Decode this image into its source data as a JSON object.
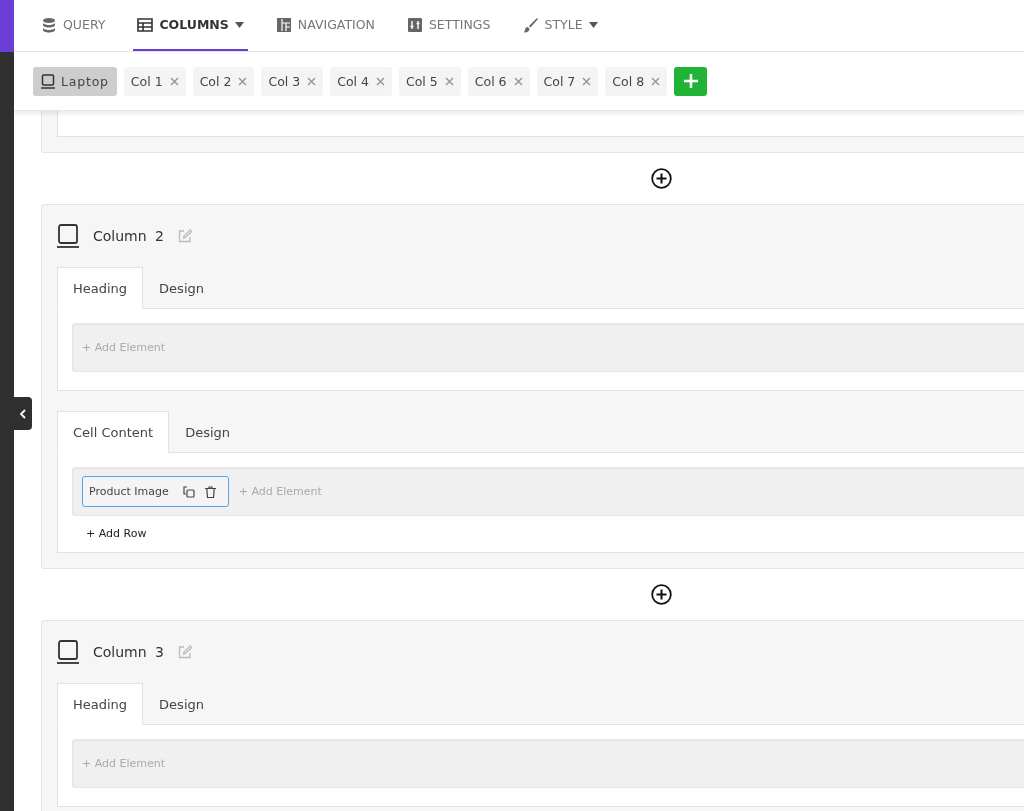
{
  "nav_tabs": [
    {
      "label": "QUERY",
      "selected": false,
      "has_menu": false
    },
    {
      "label": "COLUMNS",
      "selected": true,
      "has_menu": true
    },
    {
      "label": "NAVIGATION",
      "selected": false,
      "has_menu": false
    },
    {
      "label": "SETTINGS",
      "selected": false,
      "has_menu": false
    },
    {
      "label": "STYLE",
      "selected": false,
      "has_menu": true
    }
  ],
  "device": {
    "label": "Laptop",
    "selected": true
  },
  "column_chips": [
    {
      "label": "Col 1"
    },
    {
      "label": "Col 2"
    },
    {
      "label": "Col 3"
    },
    {
      "label": "Col 4"
    },
    {
      "label": "Col 5"
    },
    {
      "label": "Col 6"
    },
    {
      "label": "Col 7"
    },
    {
      "label": "Col 8"
    }
  ],
  "columns": [
    {
      "title": "Column",
      "number": "2",
      "sections": [
        {
          "tabs": [
            {
              "label": "Heading",
              "selected": true
            },
            {
              "label": "Design",
              "selected": false
            }
          ],
          "add_element": "+ Add Element"
        },
        {
          "tabs": [
            {
              "label": "Cell Content",
              "selected": true
            },
            {
              "label": "Design",
              "selected": false
            }
          ],
          "elements": [
            {
              "label": "Product Image"
            }
          ],
          "add_element": "+ Add Element",
          "add_row": "+ Add Row"
        }
      ]
    },
    {
      "title": "Column",
      "number": "3",
      "sections": [
        {
          "tabs": [
            {
              "label": "Heading",
              "selected": true
            },
            {
              "label": "Design",
              "selected": false
            }
          ],
          "add_element": "+ Add Element"
        }
      ]
    }
  ]
}
